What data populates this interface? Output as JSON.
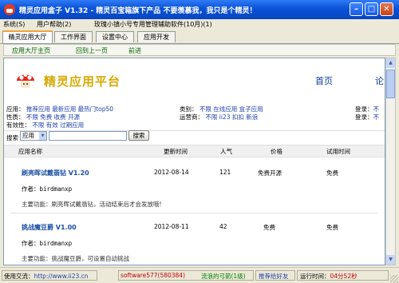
{
  "window": {
    "title": "精灵应用盒子 V1.32 - 精灵百宝箱旗下产品 不要羡慕我，我只是个精灵！"
  },
  "menu": [
    "系统(S)",
    "用户帮助(2)",
    "玫瑰小镇小号专用管理辅助软件(10月)(1)"
  ],
  "tabs": [
    "精灵应用大厅",
    "工作界面",
    "设置中心",
    "应用开发"
  ],
  "toolbar": [
    "应用大厅主页",
    "回到上一页",
    "前进"
  ],
  "site": {
    "brand": "精灵应用平台",
    "nav_home": "首页",
    "nav_more": "论"
  },
  "filters": {
    "app_label": "应用：",
    "app_links": [
      "推荐应用",
      "最新应用",
      "最热门top50"
    ],
    "nature_label": "性质：",
    "nature_links": [
      "不限",
      "免费",
      "收费",
      "开源"
    ],
    "validity_label": "有效性：",
    "validity_links": [
      "不限",
      "有效",
      "过期应用"
    ],
    "category_label": "类别：",
    "category_links": [
      "不限",
      "在线应用",
      "盒子应用"
    ],
    "operator_label": "运营商：",
    "operator_links": [
      "不限",
      "ii23",
      "扣扣",
      "新浪"
    ],
    "login_label": "登录：",
    "login_link": "不",
    "login2_label": "登录：",
    "login2_link": "不"
  },
  "search": {
    "label": "搜索",
    "select_value": "应用",
    "button": "搜索"
  },
  "table": {
    "headers": [
      "应用名称",
      "更新时间",
      "人气",
      "价格",
      "试用时间"
    ],
    "rows": [
      {
        "name": "刷亮晖试戴翡钻 V1.20",
        "date": "2012-08-14",
        "popularity": "121",
        "price": "免费开源",
        "trial": "免费",
        "author_label": "作者：",
        "author": "birdmanxp",
        "function": "主要功能：刷亮晖试戴翡钻，活动结束后才会发放哦!"
      },
      {
        "name": "挑战魔豆爵 V1.00",
        "date": "2012-08-11",
        "popularity": "42",
        "price": "免费",
        "trial": "免费",
        "author_label": "作者：",
        "author": "birdmanxp",
        "function": "主要功能：挑战魔豆爵，可设置自动挑战"
      }
    ]
  },
  "statusbar": {
    "contact_label": "使用交流：",
    "contact_url": "http://www.ii23.cn",
    "user_id": "software577(580384)",
    "user_name": "流浪的弓箭(1级)",
    "recommend": "推荐给好友",
    "runtime_label": "运行时间：",
    "runtime": "04分52秒"
  },
  "colors": {
    "titlebar": "#0a52d6",
    "brand": "#d7a800",
    "link": "#1b3fa8",
    "status_url": "#1b3fa8",
    "status_user": "#c00000",
    "status_name": "#008000"
  }
}
